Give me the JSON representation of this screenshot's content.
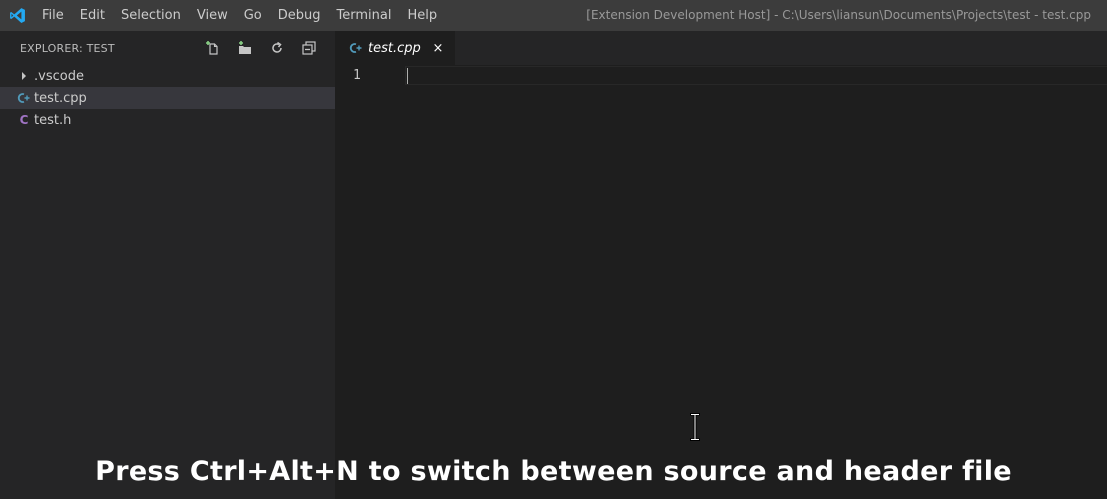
{
  "titlebar": {
    "menu": [
      "File",
      "Edit",
      "Selection",
      "View",
      "Go",
      "Debug",
      "Terminal",
      "Help"
    ],
    "window_title": "[Extension Development Host] - C:\\Users\\liansun\\Documents\\Projects\\test - test.cpp"
  },
  "sidebar": {
    "title": "EXPLORER: TEST",
    "actions": [
      "new-file-icon",
      "new-folder-icon",
      "refresh-icon",
      "collapse-all-icon"
    ],
    "items": [
      {
        "label": ".vscode",
        "type": "folder",
        "icon": "chevron-right-icon"
      },
      {
        "label": "test.cpp",
        "type": "file",
        "icon": "cpp-file-icon",
        "icon_glyph": "G",
        "icon_color": "#519aba",
        "selected": true
      },
      {
        "label": "test.h",
        "type": "file",
        "icon": "c-header-file-icon",
        "icon_glyph": "C",
        "icon_color": "#a074c4"
      }
    ]
  },
  "editor": {
    "tab": {
      "label": "test.cpp",
      "icon": "cpp-file-icon",
      "close": "×"
    },
    "line_numbers": [
      "1"
    ]
  },
  "caption": "Press Ctrl+Alt+N to switch between source and header file",
  "colors": {
    "titlebar": "#3c3c3c",
    "sidebar": "#252526",
    "editor": "#1e1e1e",
    "selection": "#37373d",
    "cpp_icon": "#519aba",
    "header_icon": "#a074c4",
    "vscode_blue": "#23a9f2"
  }
}
